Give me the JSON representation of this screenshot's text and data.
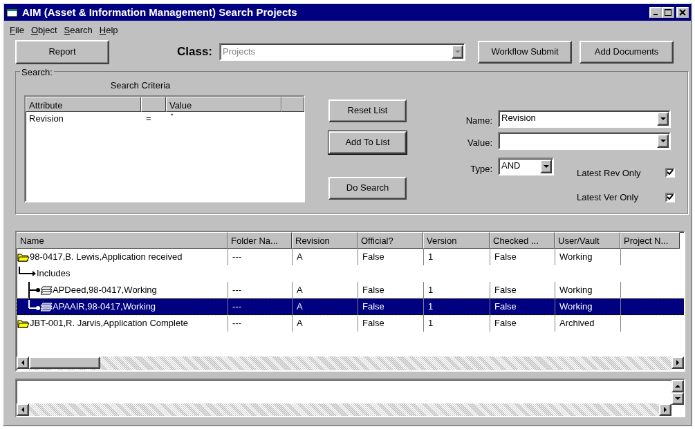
{
  "window": {
    "title": "AIM (Asset & Information Management) Search Projects"
  },
  "menu": [
    {
      "label": "File",
      "initial_underlined": true
    },
    {
      "label": "Object",
      "initial_underlined": true
    },
    {
      "label": "Search",
      "initial_underlined": true
    },
    {
      "label": "Help",
      "initial_underlined": true
    }
  ],
  "toolbar": {
    "report_button": "Report",
    "class_label": "Class:",
    "class_value": "Projects",
    "class_disabled": true,
    "buttons": [
      "Workflow Submit",
      "Add Documents"
    ]
  },
  "search": {
    "legend": "Search:",
    "criteria_title": "Search Criteria",
    "criteria_columns": [
      "Attribute",
      "Value"
    ],
    "criteria": [
      {
        "attribute": "Revision",
        "operator": "=",
        "value": "*"
      }
    ],
    "buttons": [
      {
        "label": "Reset List",
        "default": false
      },
      {
        "label": "Add To List",
        "default": true
      },
      {
        "label": "Do Search",
        "default": false
      }
    ],
    "name_field": {
      "label": "Name:",
      "value": "Revision"
    },
    "value_field": {
      "label": "Value:"
    },
    "type_field": {
      "label": "Type:",
      "value": "AND"
    },
    "checks": [
      {
        "label": "Latest Rev Only",
        "checked": true
      },
      {
        "label": "Latest Ver Only",
        "checked": true
      }
    ]
  },
  "results": {
    "columns": [
      "Name",
      "Folder Na...",
      "Revision",
      "Official?",
      "Version",
      "Checked ...",
      "User/Vault",
      "Project N..."
    ],
    "rows": [
      {
        "kind": "folder",
        "cells": [
          "98-0417,B. Lewis,Application received",
          "---",
          "A",
          "False",
          "1",
          "False",
          "Working"
        ],
        "selected": false,
        "children": [
          {
            "kind": "relation",
            "cells": [
              "Includes"
            ],
            "selected": false,
            "children": [
              {
                "kind": "document",
                "cells": [
                  "APDeed,98-0417,Working",
                  "---",
                  "A",
                  "False",
                  "1",
                  "False",
                  "Working"
                ],
                "selected": false
              },
              {
                "kind": "document",
                "cells": [
                  "APAAIR,98-0417,Working",
                  "---",
                  "A",
                  "False",
                  "1",
                  "False",
                  "Working"
                ],
                "selected": true
              }
            ]
          }
        ]
      },
      {
        "kind": "folder",
        "cells": [
          "JBT-001,R. Jarvis,Application Complete",
          "---",
          "A",
          "False",
          "1",
          "False",
          "Archived"
        ],
        "selected": false
      }
    ]
  }
}
